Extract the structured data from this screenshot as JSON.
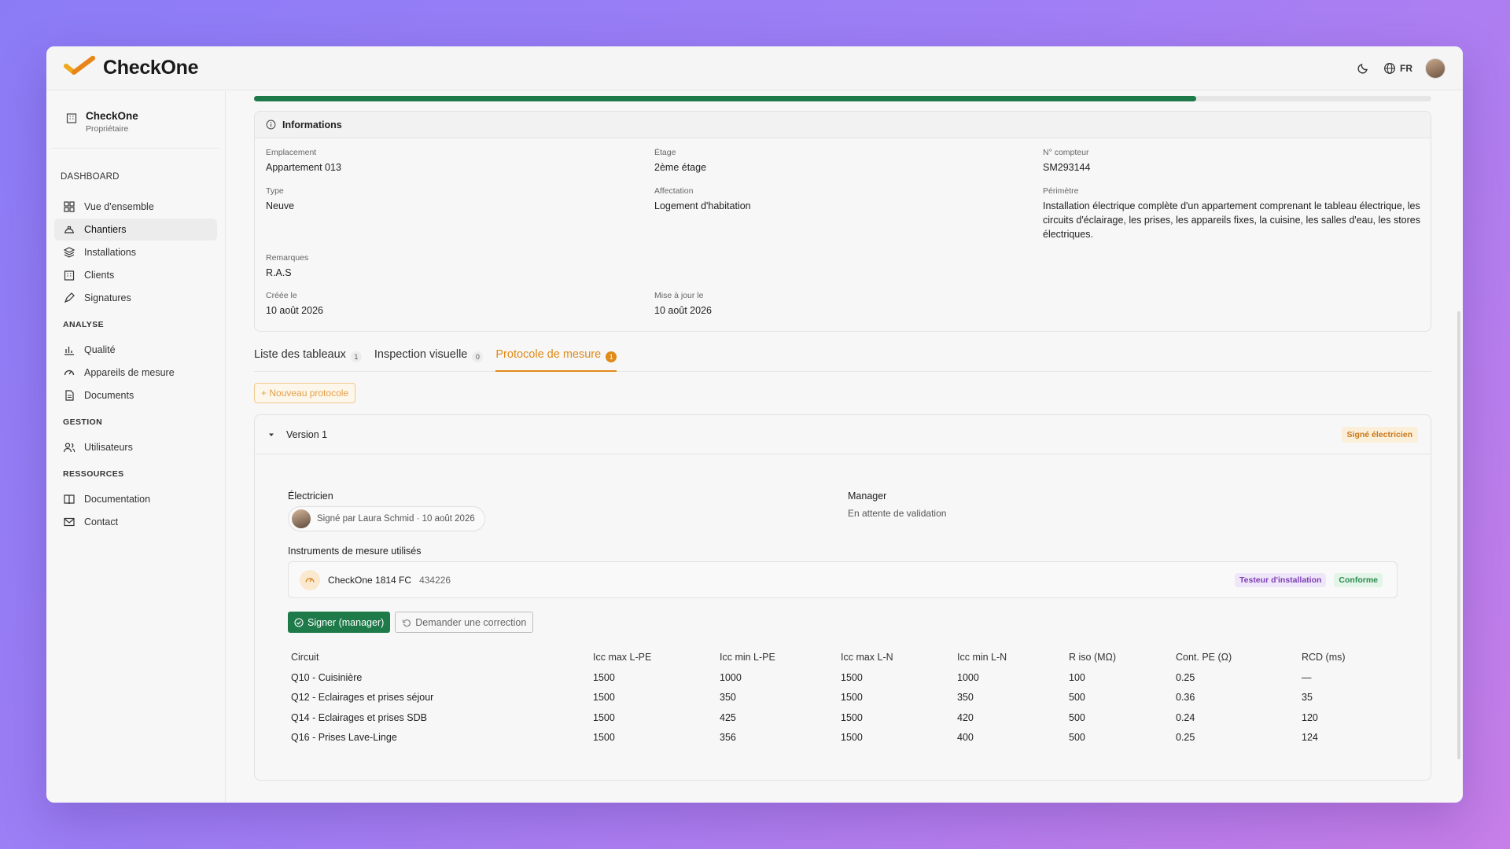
{
  "app": {
    "name": "CheckOne"
  },
  "header": {
    "lang": "FR"
  },
  "org": {
    "name": "CheckOne",
    "role": "Propriétaire"
  },
  "sidebar": {
    "dashboard_title": "DASHBOARD",
    "items": [
      {
        "label": "Vue d'ensemble"
      },
      {
        "label": "Chantiers"
      },
      {
        "label": "Installations"
      },
      {
        "label": "Clients"
      },
      {
        "label": "Signatures"
      }
    ],
    "analyse_title": "ANALYSE",
    "analyse_items": [
      {
        "label": "Qualité"
      },
      {
        "label": "Appareils de mesure"
      },
      {
        "label": "Documents"
      }
    ],
    "gestion_title": "GESTION",
    "gestion_items": [
      {
        "label": "Utilisateurs"
      }
    ],
    "ressources_title": "RESSOURCES",
    "ressources_items": [
      {
        "label": "Documentation"
      },
      {
        "label": "Contact"
      }
    ]
  },
  "progress": {
    "fraction": 0.8
  },
  "info": {
    "title": "Informations",
    "emplacement_label": "Emplacement",
    "emplacement": "Appartement 013",
    "etage_label": "Étage",
    "etage": "2ème étage",
    "compteur_label": "N° compteur",
    "compteur": "SM293144",
    "type_label": "Type",
    "type": "Neuve",
    "affectation_label": "Affectation",
    "affectation": "Logement d'habitation",
    "perimetre_label": "Périmètre",
    "perimetre": "Installation électrique complète d'un appartement comprenant le tableau électrique, les circuits d'éclairage, les prises, les appareils fixes, la cuisine, les salles d'eau, les stores électriques.",
    "remarques_label": "Remarques",
    "remarques": "R.A.S",
    "creee_label": "Créée le",
    "creee": "10 août 2026",
    "maj_label": "Mise à jour le",
    "maj": "10 août 2026"
  },
  "tabs": [
    {
      "label": "Liste des tableaux",
      "count": "1"
    },
    {
      "label": "Inspection visuelle",
      "count": "0"
    },
    {
      "label": "Protocole de mesure",
      "count": "1"
    }
  ],
  "new_protocol": "+ Nouveau protocole",
  "version": {
    "title": "Version 1",
    "status": "Signé électricien",
    "electricien_label": "Électricien",
    "signed_text": "Signé par Laura Schmid · 10 août 2026",
    "manager_label": "Manager",
    "manager_status": "En attente de validation",
    "instruments_label": "Instruments de mesure utilisés",
    "instrument": {
      "name": "CheckOne 1814 FC",
      "serial": "434226",
      "type_tag": "Testeur d'installation",
      "status_tag": "Conforme"
    },
    "sign_button": "Signer (manager)",
    "correction_button": "Demander une correction"
  },
  "table": {
    "headers": [
      "Circuit",
      "Icc max L-PE",
      "Icc min L-PE",
      "Icc max L-N",
      "Icc min L-N",
      "R iso (MΩ)",
      "Cont. PE (Ω)",
      "RCD (ms)"
    ],
    "rows": [
      [
        "Q10 - Cuisinière",
        "1500",
        "1000",
        "1500",
        "1000",
        "100",
        "0.25",
        "—"
      ],
      [
        "Q12 - Eclairages et prises séjour",
        "1500",
        "350",
        "1500",
        "350",
        "500",
        "0.36",
        "35"
      ],
      [
        "Q14 - Eclairages et prises SDB",
        "1500",
        "425",
        "1500",
        "420",
        "500",
        "0.24",
        "120"
      ],
      [
        "Q16 - Prises Lave-Linge",
        "1500",
        "356",
        "1500",
        "400",
        "500",
        "0.25",
        "124"
      ]
    ]
  },
  "colors": {
    "accent": "#e08a17",
    "green": "#1f7a4a"
  }
}
